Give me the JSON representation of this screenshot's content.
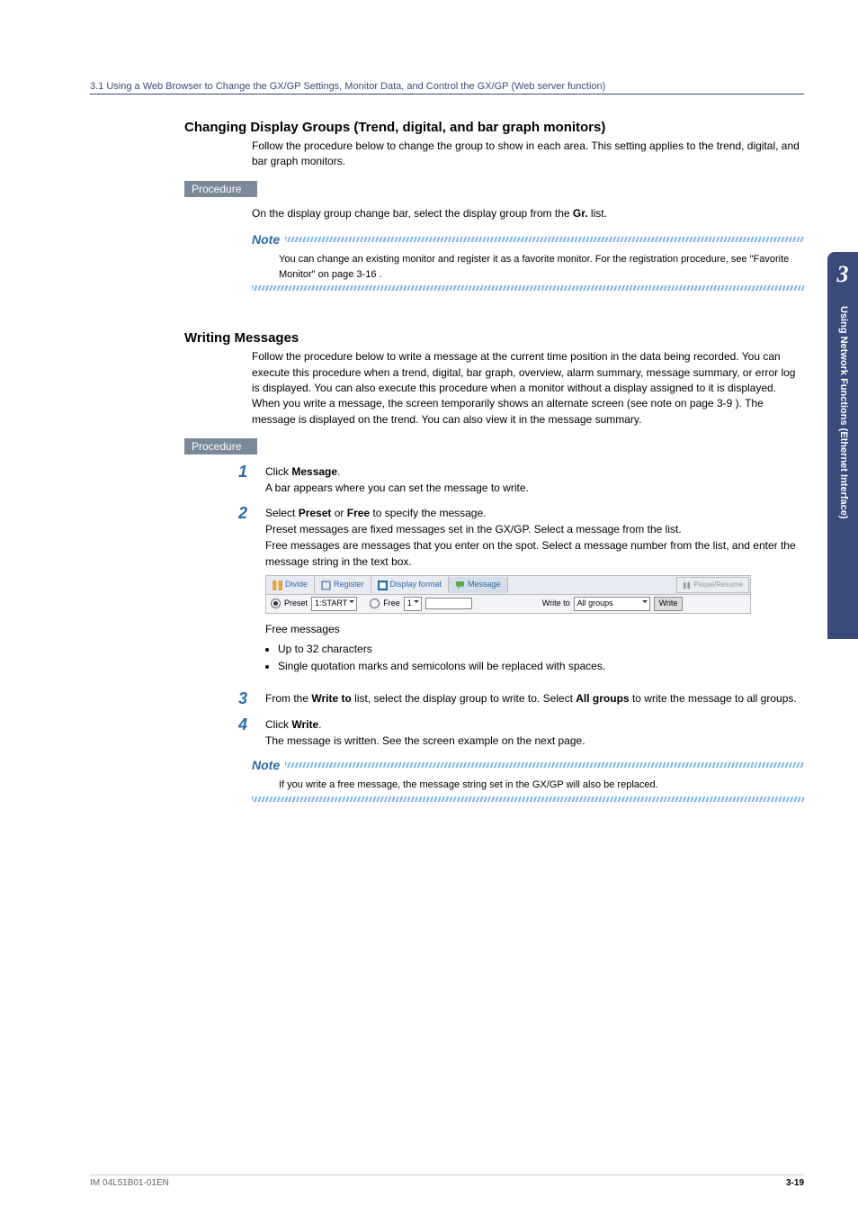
{
  "header": {
    "breadcrumb": "3.1  Using a Web Browser to Change the GX/GP Settings, Monitor Data, and Control the GX/GP (Web server function)"
  },
  "sideTab": {
    "chapter": "3",
    "label": "Using Network Functions (Ethernet Interface)"
  },
  "sec1": {
    "title": "Changing Display Groups (Trend, digital, and bar graph monitors)",
    "intro": "Follow the procedure below to change the group to show in each area. This setting applies to the trend, digital, and bar graph monitors.",
    "proc": "Procedure",
    "body_pre": "On the display group change bar, select the display group from the ",
    "body_bold": "Gr.",
    "body_post": " list.",
    "note_label": "Note",
    "note_body": "You can change an existing monitor and register it as a favorite monitor. For the registration procedure, see \"Favorite Monitor\" on page 3-16 ."
  },
  "sec2": {
    "title": "Writing Messages",
    "intro": "Follow the procedure below to write a message at the current time position in the data being recorded. You can execute this procedure when a trend, digital, bar graph, overview, alarm summary, message summary, or error log is displayed. You can also execute this procedure when a monitor without a display assigned to it is displayed. When you write a message, the screen temporarily shows an alternate screen (see note on page 3-9 ). The message is displayed on the trend. You can also view it in the message summary.",
    "proc": "Procedure",
    "step1": {
      "num": "1",
      "l1_pre": "Click ",
      "l1_b": "Message",
      "l1_post": ".",
      "l2": "A bar appears where you can set the message to write."
    },
    "step2": {
      "num": "2",
      "l1_pre": "Select ",
      "l1_b1": "Preset",
      "l1_mid": " or ",
      "l1_b2": "Free",
      "l1_post": " to specify the message.",
      "l2": "Preset messages are fixed messages set in the GX/GP. Select a message from the list.",
      "l3": "Free messages are messages that you enter on the spot. Select a message number from the list, and enter the message string in the text box.",
      "toolbar": {
        "divide": "Divide",
        "register": "Register",
        "display_format": "Display format",
        "message": "Message",
        "pause": "Pause/Resume",
        "preset": "Preset",
        "preset_val": "1:START",
        "free": "Free",
        "free_val": "1",
        "write_to": "Write to",
        "write_to_val": "All groups",
        "write_btn": "Write"
      },
      "free_head": "Free messages",
      "b1": "Up to 32 characters",
      "b2": "Single quotation marks and semicolons will be replaced with spaces."
    },
    "step3": {
      "num": "3",
      "l1_pre": "From the ",
      "l1_b1": "Write to",
      "l1_mid": " list, select the display group to write to. Select ",
      "l1_b2": "All groups",
      "l1_post": " to write the message to all groups."
    },
    "step4": {
      "num": "4",
      "l1_pre": "Click ",
      "l1_b": "Write",
      "l1_post": ".",
      "l2": "The message is written. See the screen example on the next page."
    },
    "note_label": "Note",
    "note_body": "If you write a free message, the message string set in the GX/GP will also be replaced."
  },
  "footer": {
    "left": "IM 04L51B01-01EN",
    "right": "3-19"
  }
}
